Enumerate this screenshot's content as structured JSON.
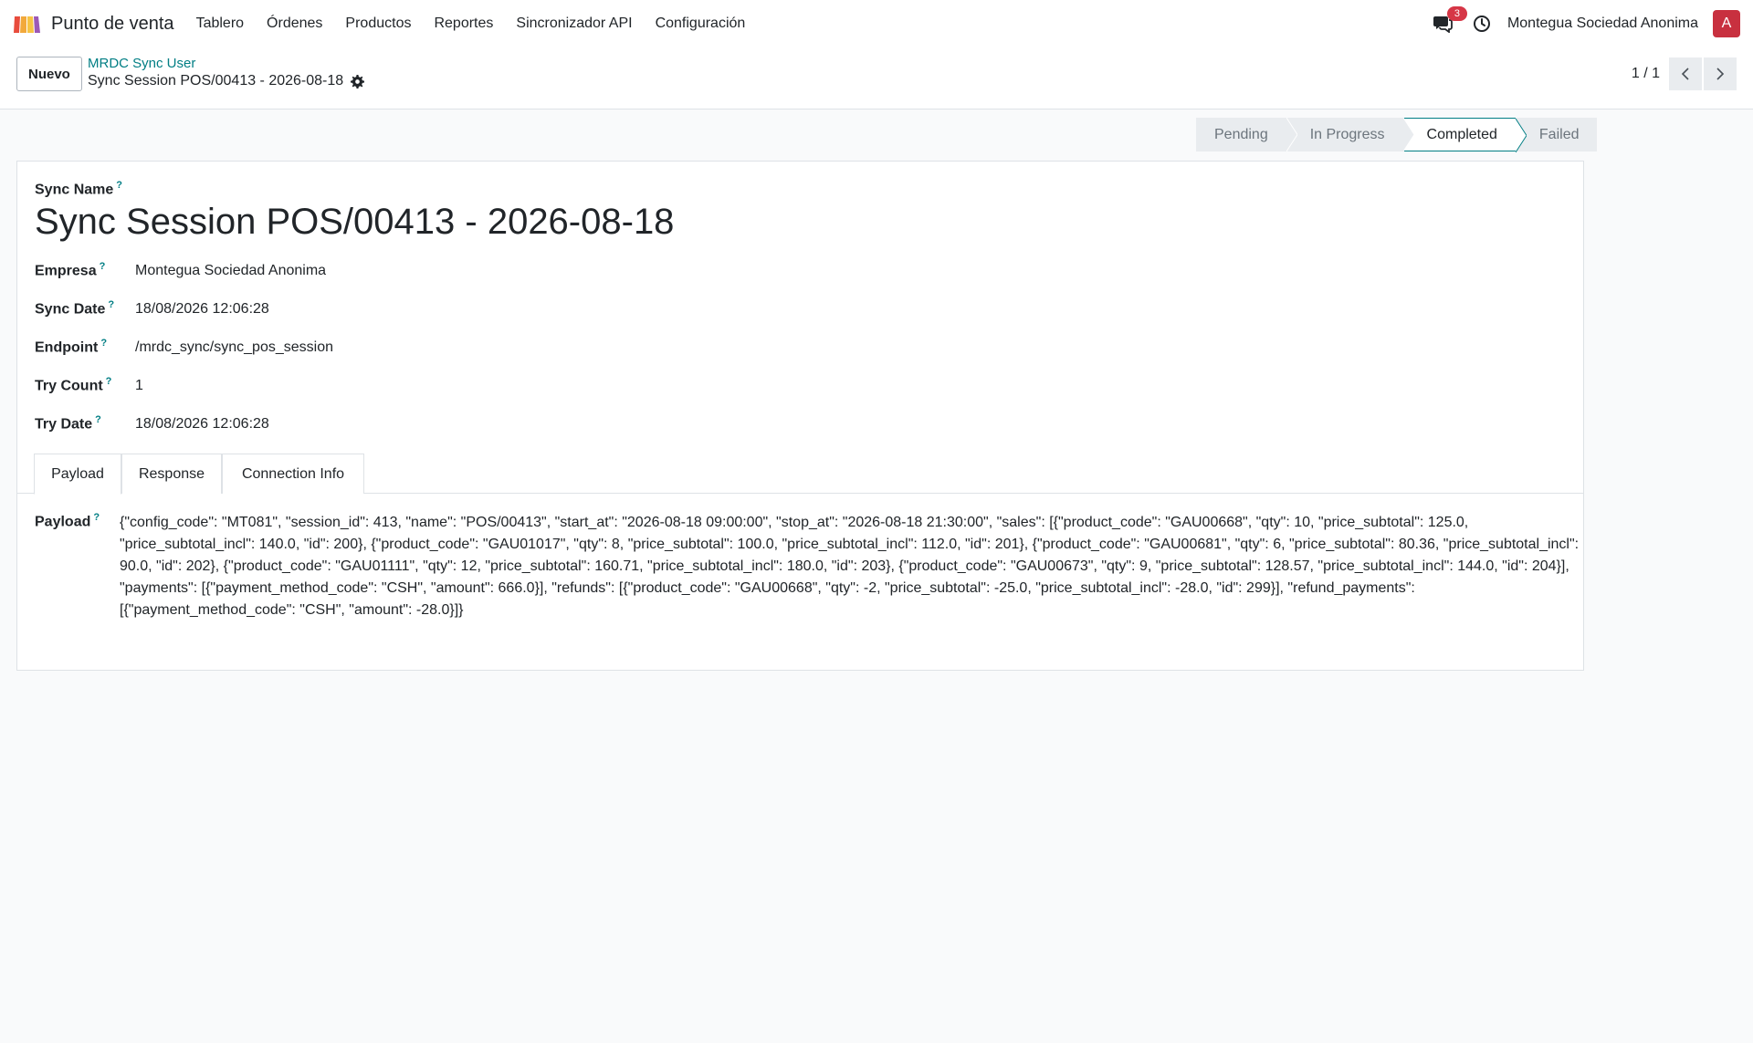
{
  "navbar": {
    "app_name": "Punto de venta",
    "menu": [
      "Tablero",
      "Órdenes",
      "Productos",
      "Reportes",
      "Sincronizador API",
      "Configuración"
    ],
    "chat_badge": "3",
    "company": "Montegua Sociedad Anonima",
    "avatar_letter": "A",
    "icons": {
      "app": "pos-app-icon",
      "chat": "chat-icon",
      "activity": "clock-icon"
    }
  },
  "control": {
    "new_label": "Nuevo",
    "breadcrumb_parent": "MRDC Sync User",
    "breadcrumb_current": "Sync Session POS/00413 - 2026-08-18",
    "pager": "1 / 1"
  },
  "statusbar": [
    "Pending",
    "In Progress",
    "Completed",
    "Failed"
  ],
  "status_active": "Completed",
  "form": {
    "title_label": "Sync Name",
    "title": "Sync Session POS/00413 - 2026-08-18",
    "help_mark": "?",
    "fields": [
      {
        "label": "Empresa",
        "value": "Montegua Sociedad Anonima"
      },
      {
        "label": "Sync Date",
        "value": "18/08/2026 12:06:28"
      },
      {
        "label": "Endpoint",
        "value": "/mrdc_sync/sync_pos_session"
      },
      {
        "label": "Try Count",
        "value": "1"
      },
      {
        "label": "Try Date",
        "value": "18/08/2026 12:06:28"
      }
    ],
    "tabs": [
      "Payload",
      "Response",
      "Connection Info"
    ],
    "active_tab": "Payload",
    "payload_label": "Payload",
    "payload": "{\"config_code\": \"MT081\", \"session_id\": 413, \"name\": \"POS/00413\", \"start_at\": \"2026-08-18 09:00:00\", \"stop_at\": \"2026-08-18 21:30:00\", \"sales\": [{\"product_code\": \"GAU00668\", \"qty\": 10, \"price_subtotal\": 125.0, \"price_subtotal_incl\": 140.0, \"id\": 200}, {\"product_code\": \"GAU01017\", \"qty\": 8, \"price_subtotal\": 100.0, \"price_subtotal_incl\": 112.0, \"id\": 201}, {\"product_code\": \"GAU00681\", \"qty\": 6, \"price_subtotal\": 80.36, \"price_subtotal_incl\": 90.0, \"id\": 202}, {\"product_code\": \"GAU01111\", \"qty\": 12, \"price_subtotal\": 160.71, \"price_subtotal_incl\": 180.0, \"id\": 203}, {\"product_code\": \"GAU00673\", \"qty\": 9, \"price_subtotal\": 128.57, \"price_subtotal_incl\": 144.0, \"id\": 204}], \"payments\": [{\"payment_method_code\": \"CSH\", \"amount\": 666.0}], \"refunds\": [{\"product_code\": \"GAU00668\", \"qty\": -2, \"price_subtotal\": -25.0, \"price_subtotal_incl\": -28.0, \"id\": 299}], \"refund_payments\": [{\"payment_method_code\": \"CSH\", \"amount\": -28.0}]}"
  },
  "colors": {
    "brand": "#017e84",
    "badge": "#d63646",
    "avatar": "#c8303f",
    "background": "#f9fafb"
  }
}
